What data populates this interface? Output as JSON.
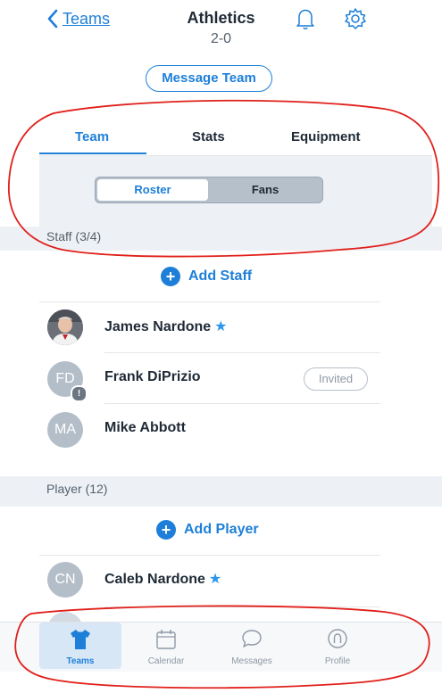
{
  "nav": {
    "back_label": "Teams",
    "title": "Athletics",
    "record": "2-0"
  },
  "message_button": "Message Team",
  "tabs": [
    {
      "label": "Team",
      "active": true
    },
    {
      "label": "Stats"
    },
    {
      "label": "Equipment"
    }
  ],
  "segment": {
    "options": [
      "Roster",
      "Fans"
    ],
    "selected": "Roster"
  },
  "staff": {
    "header": "Staff (3/4)",
    "add_label": "Add Staff",
    "members": [
      {
        "name": "James Nardone",
        "starred": true,
        "photo": true
      },
      {
        "name": "Frank DiPrizio",
        "initials": "FD",
        "status": "Invited"
      },
      {
        "name": "Mike Abbott",
        "initials": "MA"
      }
    ]
  },
  "players": {
    "header": "Player (12)",
    "add_label": "Add Player",
    "members": [
      {
        "name": "Caleb Nardone",
        "initials": "CN",
        "starred": true
      }
    ]
  },
  "tabbar": [
    {
      "label": "Teams",
      "icon": "jersey-icon",
      "active": true
    },
    {
      "label": "Calendar",
      "icon": "calendar-icon"
    },
    {
      "label": "Messages",
      "icon": "chat-bubble-icon"
    },
    {
      "label": "Profile",
      "icon": "profile-icon"
    }
  ],
  "colors": {
    "accent": "#1e7fd8",
    "annotation": "#e0201b",
    "panel": "#edf1f6"
  }
}
